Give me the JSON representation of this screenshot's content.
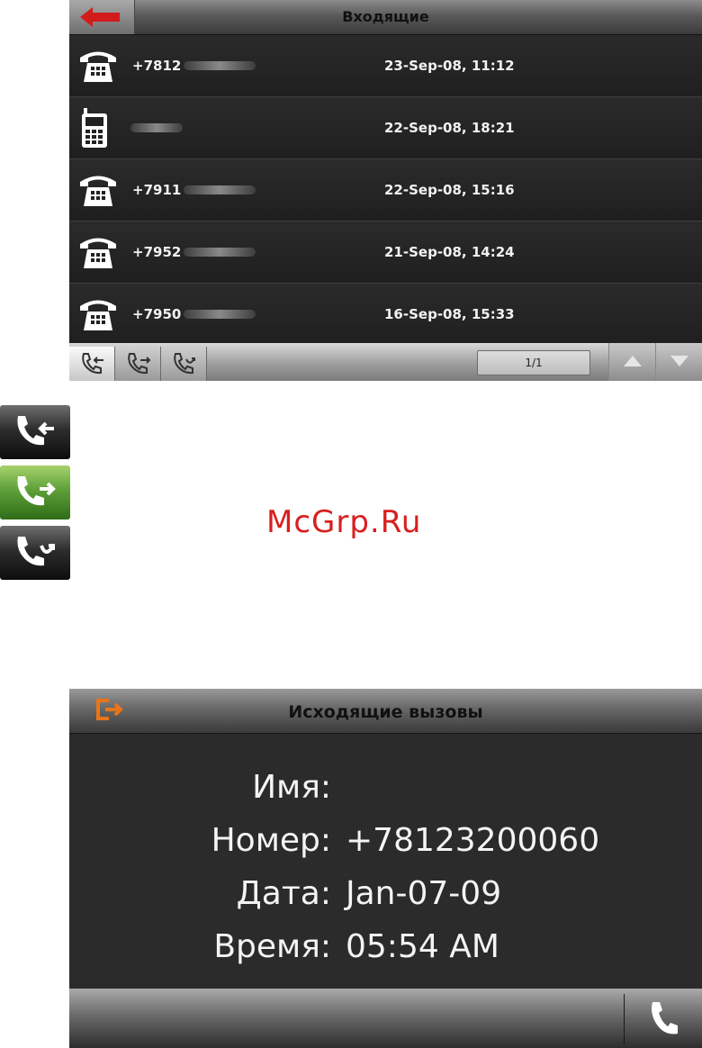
{
  "incoming_screen": {
    "title": "Входящие",
    "back_icon": "back-arrow-icon",
    "calls": [
      {
        "type": "landline",
        "number": "+7812",
        "datetime": "23-Sep-08, 11:12"
      },
      {
        "type": "mobile",
        "number": "",
        "datetime": "22-Sep-08, 18:21"
      },
      {
        "type": "landline",
        "number": "+7911",
        "datetime": "22-Sep-08, 15:16"
      },
      {
        "type": "landline",
        "number": "+7952",
        "datetime": "21-Sep-08, 14:24"
      },
      {
        "type": "landline",
        "number": "+7950",
        "datetime": "16-Sep-08, 15:33"
      }
    ],
    "footer": {
      "tabs": [
        "incoming-calls",
        "outgoing-calls",
        "missed-calls"
      ],
      "active_tab": "incoming-calls",
      "page_indicator": "1/1"
    }
  },
  "legend_icons": [
    {
      "name": "incoming-call-icon",
      "style": "dark"
    },
    {
      "name": "outgoing-call-icon",
      "style": "green"
    },
    {
      "name": "missed-call-icon",
      "style": "dark"
    }
  ],
  "watermark": "McGrp.Ru",
  "outgoing_screen": {
    "title": "Исходящие вызовы",
    "fields": [
      {
        "label": "Имя:",
        "value": ""
      },
      {
        "label": "Номер:",
        "value": "+78123200060"
      },
      {
        "label": "Дата:",
        "value": "Jan-07-09"
      },
      {
        "label": "Время:",
        "value": "05:54 AM"
      }
    ]
  },
  "colors": {
    "accent_red": "#d81f1f",
    "exit_orange": "#e8751a",
    "active_green": "#5fa03a",
    "screen_bg": "#232323"
  }
}
